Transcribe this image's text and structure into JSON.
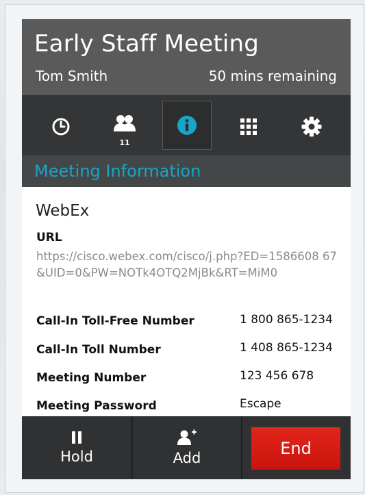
{
  "meeting": {
    "title": "Early Staff Meeting",
    "caller": "Tom Smith",
    "remaining": "50 mins remaining"
  },
  "toolbar": {
    "items": [
      {
        "icon": "clock-icon"
      },
      {
        "icon": "participants-icon",
        "badge": "11"
      },
      {
        "icon": "info-icon",
        "active": true
      },
      {
        "icon": "keypad-icon"
      },
      {
        "icon": "gear-icon"
      }
    ]
  },
  "section": {
    "title": "Meeting Information"
  },
  "info": {
    "provider": "WebEx",
    "url_label": "URL",
    "url_value": "https://cisco.webex.com/cisco/j.php?ED=1586608 67&UID=0&PW=NOTk4OTQ2MjBk&RT=MiM0",
    "rows": [
      {
        "label": "Call-In Toll-Free Number",
        "value": "1 800 865-1234"
      },
      {
        "label": "Call-In Toll Number",
        "value": "1 408 865-1234"
      },
      {
        "label": "Meeting Number",
        "value": "123 456 678"
      },
      {
        "label": "Meeting Password",
        "value": "Escape"
      }
    ]
  },
  "actions": {
    "hold": "Hold",
    "add": "Add",
    "end": "End"
  },
  "colors": {
    "accent": "#19a4c9",
    "end": "#d81d14"
  }
}
